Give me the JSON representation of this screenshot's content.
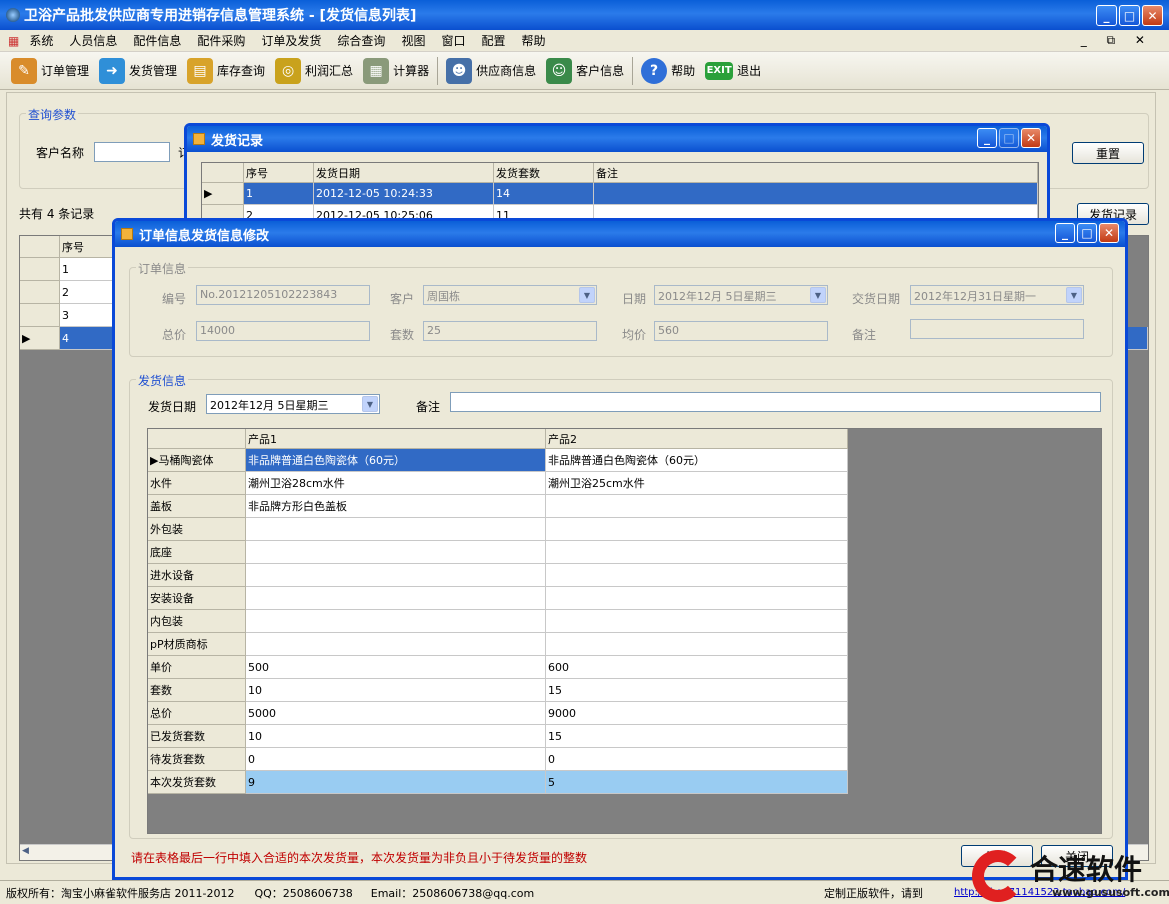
{
  "window": {
    "title": "卫浴产品批发供应商专用进销存信息管理系统 - [发货信息列表]"
  },
  "menu": [
    "系统",
    "人员信息",
    "配件信息",
    "配件采购",
    "订单及发货",
    "综合查询",
    "视图",
    "窗口",
    "配置",
    "帮助"
  ],
  "toolbar": [
    {
      "label": "订单管理",
      "icon": "order-icon",
      "color": "#d98c2b"
    },
    {
      "label": "发货管理",
      "icon": "shipping-icon",
      "color": "#2f8fd8"
    },
    {
      "label": "库存查询",
      "icon": "warehouse-icon",
      "color": "#d8a32a"
    },
    {
      "label": "利润汇总",
      "icon": "coins-icon",
      "color": "#c9a21c"
    },
    {
      "label": "计算器",
      "icon": "calculator-icon",
      "color": "#8a9a7a"
    },
    {
      "label": "供应商信息",
      "icon": "supplier-icon",
      "color": "#4670a8"
    },
    {
      "label": "客户信息",
      "icon": "customer-icon",
      "color": "#3a8a4a"
    },
    {
      "label": "帮助",
      "icon": "help-icon",
      "color": "#2f6fd8"
    },
    {
      "label": "退出",
      "icon": "exit-icon",
      "color": "#2aa03a"
    }
  ],
  "query": {
    "legend": "查询参数",
    "customer_label": "客户名称",
    "customer_value": "",
    "truncated_label": "订",
    "reset_label": "重置"
  },
  "list": {
    "count_text": "共有 4 条记录",
    "header": "序号",
    "rows": [
      "1",
      "2",
      "3",
      "4"
    ],
    "record_button": "发货记录"
  },
  "shipping_records": {
    "title": "发货记录",
    "columns": [
      "序号",
      "发货日期",
      "发货套数",
      "备注"
    ],
    "rows": [
      [
        "1",
        "2012-12-05 10:24:33",
        "14",
        ""
      ],
      [
        "2",
        "2012-12-05 10:25:06",
        "11",
        ""
      ]
    ]
  },
  "edit_dialog": {
    "title": "订单信息发货信息修改",
    "order": {
      "legend": "订单信息",
      "no_label": "编号",
      "no_value": "No.20121205102223843",
      "customer_label": "客户",
      "customer_value": "周国栋",
      "date_label": "日期",
      "date_value": "2012年12月 5日星期三",
      "deliver_label": "交货日期",
      "deliver_value": "2012年12月31日星期一",
      "total_label": "总价",
      "total_value": "14000",
      "sets_label": "套数",
      "sets_value": "25",
      "avg_label": "均价",
      "avg_value": "560",
      "remark_label": "备注",
      "remark_value": ""
    },
    "ship": {
      "legend": "发货信息",
      "date_label": "发货日期",
      "date_value": "2012年12月 5日星期三",
      "remark_label": "备注",
      "remark_value": ""
    },
    "grid": {
      "columns": [
        "产品1",
        "产品2"
      ],
      "rows": [
        {
          "label": "马桶陶瓷体",
          "v1": "非品牌普通白色陶瓷体（60元）",
          "v2": "非品牌普通白色陶瓷体（60元）"
        },
        {
          "label": "水件",
          "v1": "潮州卫浴28cm水件",
          "v2": "潮州卫浴25cm水件"
        },
        {
          "label": "盖板",
          "v1": "非品牌方形白色盖板",
          "v2": ""
        },
        {
          "label": "外包装",
          "v1": "",
          "v2": ""
        },
        {
          "label": "底座",
          "v1": "",
          "v2": ""
        },
        {
          "label": "进水设备",
          "v1": "",
          "v2": ""
        },
        {
          "label": "安装设备",
          "v1": "",
          "v2": ""
        },
        {
          "label": "内包装",
          "v1": "",
          "v2": ""
        },
        {
          "label": "pP材质商标",
          "v1": "",
          "v2": ""
        },
        {
          "label": "单价",
          "v1": "500",
          "v2": "600"
        },
        {
          "label": "套数",
          "v1": "10",
          "v2": "15"
        },
        {
          "label": "总价",
          "v1": "5000",
          "v2": "9000"
        },
        {
          "label": "已发货套数",
          "v1": "10",
          "v2": "15"
        },
        {
          "label": "待发货套数",
          "v1": "0",
          "v2": "0"
        },
        {
          "label": "本次发货套数",
          "v1": "9",
          "v2": "5"
        }
      ]
    },
    "hint": "请在表格最后一行中填入合适的本次发货量，本次发货量为非负且小于待发货量的整数",
    "modify_label": "修改",
    "close_label": "关闭"
  },
  "status": {
    "copyright": "版权所有：淘宝小麻雀软件服务店 2011-2012",
    "qq": "QQ：2508606738",
    "email": "Email：2508606738@qq.com",
    "custom": "定制正版软件，请到",
    "link": "http://shop71141522.taobao.com/"
  },
  "watermark": {
    "text": "合速软件",
    "url": "www.gususoft.com"
  }
}
